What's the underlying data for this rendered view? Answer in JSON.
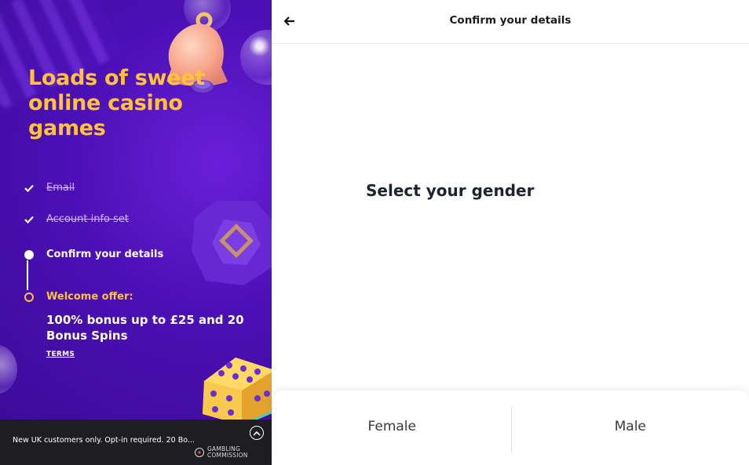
{
  "left": {
    "headline": "Loads of sweet online casino games",
    "steps": [
      {
        "label": "Email",
        "state": "done"
      },
      {
        "label": "Account info set",
        "state": "done"
      },
      {
        "label": "Confirm your details",
        "state": "active"
      },
      {
        "label": "Welcome offer:",
        "state": "upcoming"
      }
    ],
    "offer": {
      "text": "100% bonus up to £25 and 20 Bonus Spins",
      "terms_label": "TERMS"
    },
    "bottom_bar": {
      "disclaimer": "New UK customers only. Opt-in required. 20 Bo...",
      "regulator_line1": "GAMBLING",
      "regulator_line2": "COMMISSION"
    }
  },
  "right": {
    "header_title": "Confirm your details",
    "question": "Select your gender",
    "options": [
      {
        "label": "Female"
      },
      {
        "label": "Male"
      }
    ]
  },
  "colors": {
    "accent_yellow": "#ffc23a",
    "panel_purple": "#4b10b5",
    "bottom_bar": "#1e1e22"
  },
  "icons": {
    "back": "arrow-left-icon",
    "check": "check-icon",
    "expand": "chevron-up-icon"
  }
}
